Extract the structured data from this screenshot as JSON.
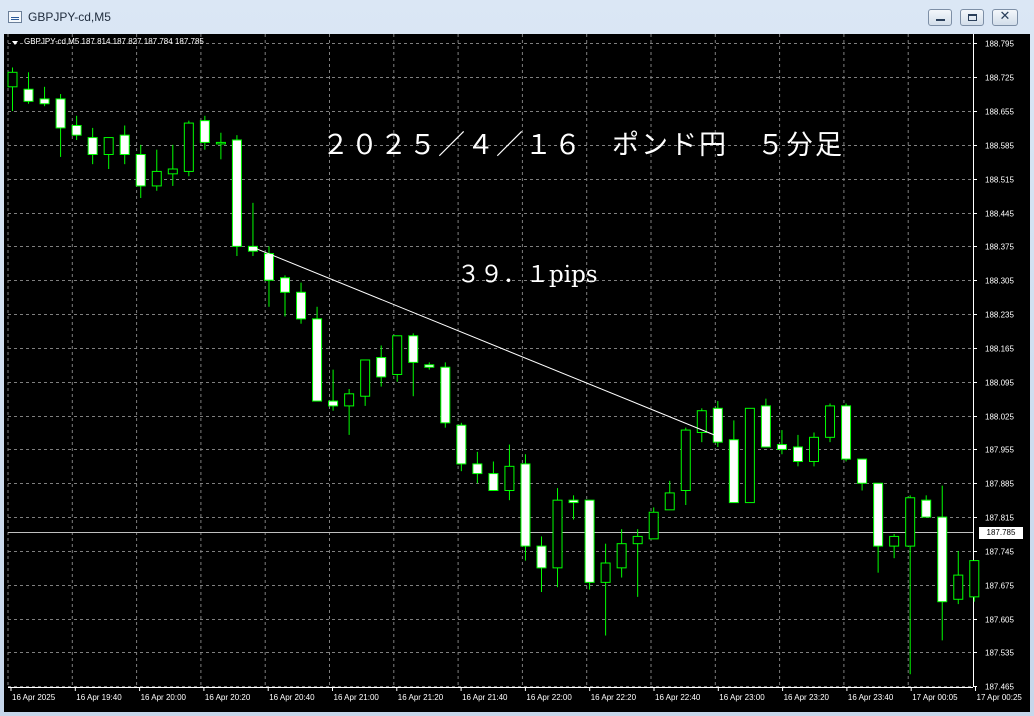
{
  "window": {
    "title": "GBPJPY-cd,M5",
    "close_glyph": "✕"
  },
  "header": {
    "symbol_ohlc": "GBPJPY-cd,M5  187.814 187.827 187.784 187.785"
  },
  "annotations": {
    "title": "２０２５／４／１６　ポンド円　５分足",
    "pips": "３９．１pips"
  },
  "current_price_label": "187.785",
  "colors": {
    "background": "#000000",
    "grid": "#7f7f7f",
    "candle_up": "#000000",
    "candle_down": "#ffffff",
    "wick": "#00ff00",
    "axis_text": "#ffffff"
  },
  "chart_data": {
    "type": "candlestick",
    "y_ticks": [
      "188.795",
      "188.725",
      "188.655",
      "188.585",
      "188.515",
      "188.445",
      "188.375",
      "188.305",
      "188.235",
      "188.165",
      "188.095",
      "188.025",
      "187.955",
      "187.885",
      "187.815",
      "187.745",
      "187.675",
      "187.605",
      "187.535",
      "187.465"
    ],
    "x_ticks": [
      "16 Apr 2025",
      "16 Apr 19:40",
      "16 Apr 20:00",
      "16 Apr 20:20",
      "16 Apr 20:40",
      "16 Apr 21:00",
      "16 Apr 21:20",
      "16 Apr 21:40",
      "16 Apr 22:00",
      "16 Apr 22:20",
      "16 Apr 22:40",
      "16 Apr 23:00",
      "16 Apr 23:20",
      "16 Apr 23:40",
      "17 Apr 00:05",
      "17 Apr 00:25"
    ],
    "ylim": [
      187.465,
      188.795
    ],
    "current_price": 187.785,
    "grid": true,
    "candles": [
      {
        "o": 188.705,
        "h": 188.745,
        "l": 188.655,
        "c": 188.735
      },
      {
        "o": 188.7,
        "h": 188.735,
        "l": 188.67,
        "c": 188.675
      },
      {
        "o": 188.68,
        "h": 188.705,
        "l": 188.665,
        "c": 188.67
      },
      {
        "o": 188.68,
        "h": 188.69,
        "l": 188.56,
        "c": 188.62
      },
      {
        "o": 188.625,
        "h": 188.645,
        "l": 188.595,
        "c": 188.605
      },
      {
        "o": 188.6,
        "h": 188.62,
        "l": 188.545,
        "c": 188.565
      },
      {
        "o": 188.565,
        "h": 188.585,
        "l": 188.535,
        "c": 188.6
      },
      {
        "o": 188.605,
        "h": 188.625,
        "l": 188.545,
        "c": 188.565
      },
      {
        "o": 188.565,
        "h": 188.585,
        "l": 188.475,
        "c": 188.5
      },
      {
        "o": 188.5,
        "h": 188.575,
        "l": 188.49,
        "c": 188.53
      },
      {
        "o": 188.525,
        "h": 188.585,
        "l": 188.5,
        "c": 188.535
      },
      {
        "o": 188.53,
        "h": 188.635,
        "l": 188.52,
        "c": 188.63
      },
      {
        "o": 188.635,
        "h": 188.645,
        "l": 188.575,
        "c": 188.59
      },
      {
        "o": 188.59,
        "h": 188.61,
        "l": 188.555,
        "c": 188.59
      },
      {
        "o": 188.595,
        "h": 188.605,
        "l": 188.355,
        "c": 188.375
      },
      {
        "o": 188.375,
        "h": 188.465,
        "l": 188.355,
        "c": 188.365
      },
      {
        "o": 188.36,
        "h": 188.375,
        "l": 188.25,
        "c": 188.305
      },
      {
        "o": 188.31,
        "h": 188.315,
        "l": 188.23,
        "c": 188.28
      },
      {
        "o": 188.28,
        "h": 188.3,
        "l": 188.215,
        "c": 188.225
      },
      {
        "o": 188.225,
        "h": 188.25,
        "l": 188.055,
        "c": 188.055
      },
      {
        "o": 188.055,
        "h": 188.12,
        "l": 188.035,
        "c": 188.045
      },
      {
        "o": 188.045,
        "h": 188.08,
        "l": 187.985,
        "c": 188.07
      },
      {
        "o": 188.065,
        "h": 188.14,
        "l": 188.045,
        "c": 188.14
      },
      {
        "o": 188.145,
        "h": 188.17,
        "l": 188.085,
        "c": 188.105
      },
      {
        "o": 188.11,
        "h": 188.19,
        "l": 188.095,
        "c": 188.19
      },
      {
        "o": 188.19,
        "h": 188.195,
        "l": 188.065,
        "c": 188.135
      },
      {
        "o": 188.13,
        "h": 188.135,
        "l": 188.12,
        "c": 188.125
      },
      {
        "o": 188.125,
        "h": 188.135,
        "l": 188.0,
        "c": 188.01
      },
      {
        "o": 188.005,
        "h": 188.01,
        "l": 187.91,
        "c": 187.925
      },
      {
        "o": 187.925,
        "h": 187.95,
        "l": 187.885,
        "c": 187.905
      },
      {
        "o": 187.905,
        "h": 187.93,
        "l": 187.87,
        "c": 187.87
      },
      {
        "o": 187.87,
        "h": 187.965,
        "l": 187.85,
        "c": 187.92
      },
      {
        "o": 187.925,
        "h": 187.945,
        "l": 187.725,
        "c": 187.755
      },
      {
        "o": 187.755,
        "h": 187.775,
        "l": 187.66,
        "c": 187.71
      },
      {
        "o": 187.71,
        "h": 187.875,
        "l": 187.67,
        "c": 187.85
      },
      {
        "o": 187.85,
        "h": 187.86,
        "l": 187.81,
        "c": 187.845
      },
      {
        "o": 187.85,
        "h": 187.85,
        "l": 187.665,
        "c": 187.68
      },
      {
        "o": 187.68,
        "h": 187.76,
        "l": 187.57,
        "c": 187.72
      },
      {
        "o": 187.71,
        "h": 187.79,
        "l": 187.69,
        "c": 187.76
      },
      {
        "o": 187.76,
        "h": 187.79,
        "l": 187.65,
        "c": 187.775
      },
      {
        "o": 187.77,
        "h": 187.835,
        "l": 187.77,
        "c": 187.825
      },
      {
        "o": 187.83,
        "h": 187.89,
        "l": 187.83,
        "c": 187.865
      },
      {
        "o": 187.87,
        "h": 188.0,
        "l": 187.84,
        "c": 187.995
      },
      {
        "o": 187.99,
        "h": 188.04,
        "l": 187.97,
        "c": 188.035
      },
      {
        "o": 188.04,
        "h": 188.055,
        "l": 187.96,
        "c": 187.97
      },
      {
        "o": 187.975,
        "h": 188.015,
        "l": 187.845,
        "c": 187.845
      },
      {
        "o": 187.845,
        "h": 188.04,
        "l": 187.845,
        "c": 188.04
      },
      {
        "o": 188.045,
        "h": 188.06,
        "l": 187.96,
        "c": 187.96
      },
      {
        "o": 187.965,
        "h": 187.995,
        "l": 187.945,
        "c": 187.955
      },
      {
        "o": 187.96,
        "h": 187.985,
        "l": 187.92,
        "c": 187.93
      },
      {
        "o": 187.93,
        "h": 187.99,
        "l": 187.92,
        "c": 187.98
      },
      {
        "o": 187.98,
        "h": 188.05,
        "l": 187.97,
        "c": 188.045
      },
      {
        "o": 188.045,
        "h": 188.05,
        "l": 187.93,
        "c": 187.935
      },
      {
        "o": 187.935,
        "h": 187.935,
        "l": 187.87,
        "c": 187.885
      },
      {
        "o": 187.885,
        "h": 187.885,
        "l": 187.7,
        "c": 187.755
      },
      {
        "o": 187.755,
        "h": 187.78,
        "l": 187.73,
        "c": 187.775
      },
      {
        "o": 187.755,
        "h": 187.86,
        "l": 187.49,
        "c": 187.855
      },
      {
        "o": 187.85,
        "h": 187.86,
        "l": 187.815,
        "c": 187.815
      },
      {
        "o": 187.815,
        "h": 187.88,
        "l": 187.56,
        "c": 187.64
      },
      {
        "o": 187.645,
        "h": 187.745,
        "l": 187.635,
        "c": 187.695
      },
      {
        "o": 187.65,
        "h": 187.725,
        "l": 187.64,
        "c": 187.725
      }
    ],
    "trendline": [
      {
        "candle": 15,
        "price": 188.373
      },
      {
        "candle": 44,
        "price": 187.982
      }
    ]
  }
}
